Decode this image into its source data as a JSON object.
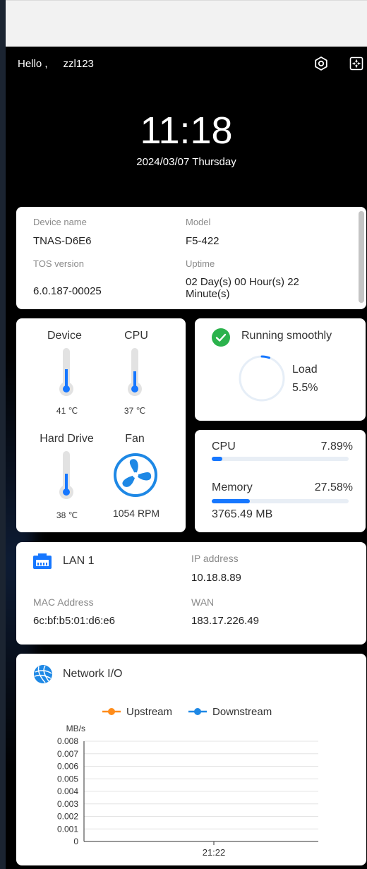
{
  "header": {
    "greeting": "Hello ,",
    "username": "zzl123",
    "time": "11:18",
    "date": "2024/03/07 Thursday",
    "icons": [
      "settings-icon",
      "exit-fullscreen-icon"
    ]
  },
  "device_info": {
    "device_name_label": "Device name",
    "device_name": "TNAS-D6E6",
    "model_label": "Model",
    "model": "F5-422",
    "tos_label": "TOS version",
    "tos_version": "6.0.187-00025",
    "uptime_label": "Uptime",
    "uptime_line1": "02 Day(s) 00 Hour(s) 22",
    "uptime_line2": "Minute(s)"
  },
  "temps": {
    "device_label": "Device",
    "device_temp": "41 ℃",
    "device_level": 0.45,
    "cpu_label": "CPU",
    "cpu_temp": "37 ℃",
    "cpu_level": 0.4,
    "hdd_label": "Hard Drive",
    "hdd_temp": "38 ℃",
    "hdd_level": 0.42,
    "fan_label": "Fan",
    "fan_speed": "1054 RPM"
  },
  "status": {
    "text": "Running smoothly",
    "load_label": "Load",
    "load_value": "5.5%",
    "load_fraction": 0.055
  },
  "usage": {
    "cpu_label": "CPU",
    "cpu_value": "7.89%",
    "cpu_fraction": 0.0789,
    "memory_label": "Memory",
    "memory_value": "27.58%",
    "memory_fraction": 0.2758,
    "memory_used": "3765.49 MB"
  },
  "network": {
    "lan_name": "LAN 1",
    "ip_label": "IP address",
    "ip": "10.18.8.89",
    "mac_label": "MAC Address",
    "mac": "6c:bf:b5:01:d6:e6",
    "wan_label": "WAN",
    "wan": "183.17.226.49"
  },
  "network_io": {
    "title": "Network I/O"
  },
  "colors": {
    "accent": "#1677ff",
    "upstream": "#ff8c1a",
    "downstream": "#1e88e5",
    "success": "#2bb24c"
  },
  "chart_data": {
    "type": "line",
    "ylabel": "MB/s",
    "x": [
      "21:22"
    ],
    "ylim": [
      0,
      0.008
    ],
    "yticks": [
      "0.008",
      "0.007",
      "0.006",
      "0.005",
      "0.004",
      "0.003",
      "0.002",
      "0.001",
      "0"
    ],
    "legend_position": "top",
    "grid": true,
    "series": [
      {
        "name": "Upstream",
        "values": [],
        "color": "#ff8c1a"
      },
      {
        "name": "Downstream",
        "values": [],
        "color": "#1e88e5"
      }
    ]
  }
}
